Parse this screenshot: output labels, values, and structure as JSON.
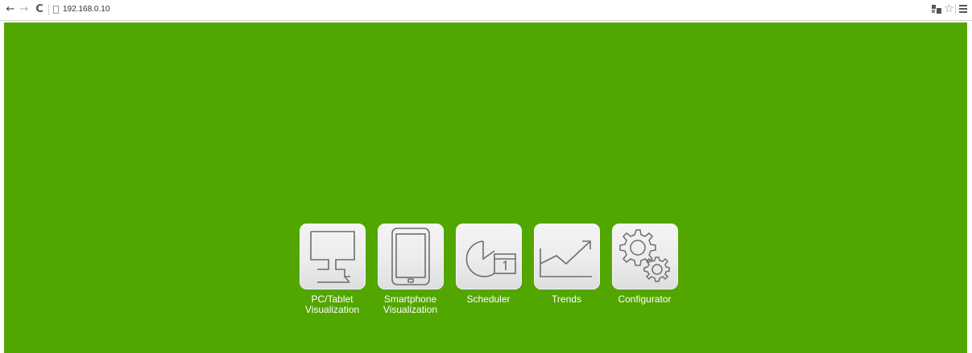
{
  "browser": {
    "url": "192.168.0.10",
    "back_glyph": "←",
    "forward_glyph": "→",
    "reload_glyph": "C",
    "star_glyph": "☆"
  },
  "page": {
    "background_color": "#52a600"
  },
  "apps": [
    {
      "label": "PC/Tablet\nVisualization",
      "icon": "monitor-icon"
    },
    {
      "label": "Smartphone\nVisualization",
      "icon": "tablet-icon"
    },
    {
      "label": "Scheduler",
      "icon": "clock-calendar-icon"
    },
    {
      "label": "Trends",
      "icon": "trend-chart-icon"
    },
    {
      "label": "Configurator",
      "icon": "gears-icon"
    }
  ]
}
